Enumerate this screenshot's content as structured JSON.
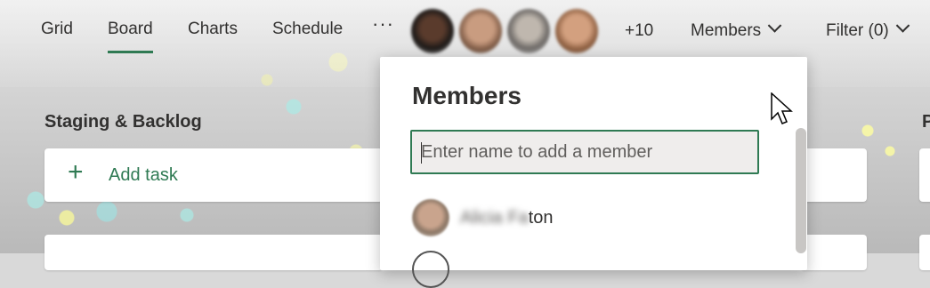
{
  "nav": {
    "tabs": [
      "Grid",
      "Board",
      "Charts",
      "Schedule"
    ],
    "more": "···",
    "overflow_count": "+10",
    "members_label": "Members",
    "filter_label": "Filter (0)"
  },
  "board": {
    "column_title": "Staging & Backlog",
    "add_task": "Add task",
    "next_column_initial": "P"
  },
  "members_panel": {
    "title": "Members",
    "input_placeholder": "Enter name to add a member",
    "member_name_blurred": "Alicia Fa",
    "member_name_visible": "ton"
  },
  "colors": {
    "accent": "#2f7a53"
  }
}
